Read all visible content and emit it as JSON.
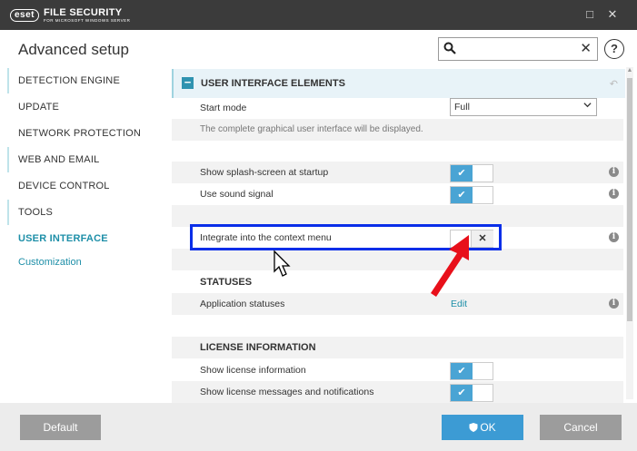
{
  "window": {
    "logo_badge": "eset",
    "logo_main": "FILE SECURITY",
    "logo_sub": "FOR MICROSOFT WINDOWS SERVER",
    "minimize_glyph": "□",
    "close_glyph": "✕"
  },
  "header": {
    "title": "Advanced setup",
    "search": {
      "value": "",
      "placeholder": ""
    },
    "help_label": "?"
  },
  "sidebar": {
    "items": [
      {
        "label": "DETECTION ENGINE",
        "active": false
      },
      {
        "label": "UPDATE",
        "active": false
      },
      {
        "label": "NETWORK PROTECTION",
        "active": false
      },
      {
        "label": "WEB AND EMAIL",
        "active": false
      },
      {
        "label": "DEVICE CONTROL",
        "active": false
      },
      {
        "label": "TOOLS",
        "active": false
      },
      {
        "label": "USER INTERFACE",
        "active": true
      }
    ],
    "sub_item": "Customization"
  },
  "content": {
    "section_title": "USER INTERFACE ELEMENTS",
    "start_mode": {
      "label": "Start mode",
      "value": "Full"
    },
    "start_mode_desc": "The complete graphical user interface will be displayed.",
    "splash": {
      "label": "Show splash-screen at startup",
      "on": true
    },
    "sound": {
      "label": "Use sound signal",
      "on": true
    },
    "context_menu": {
      "label": "Integrate into the context menu",
      "on": false
    },
    "statuses_title": "STATUSES",
    "app_statuses": {
      "label": "Application statuses",
      "link": "Edit"
    },
    "license_title": "LICENSE INFORMATION",
    "show_license": {
      "label": "Show license information",
      "on": true
    },
    "license_messages": {
      "label": "Show license messages and notifications",
      "on": true
    }
  },
  "glyphs": {
    "check": "✔",
    "x": "✕",
    "info": "i",
    "reset": "↶",
    "minus": "−"
  },
  "footer": {
    "default_label": "Default",
    "ok_label": "OK",
    "cancel_label": "Cancel"
  },
  "colors": {
    "accent": "#1e8fa8",
    "toggle_on": "#4aa4d4",
    "highlight_border": "#0a2ee8",
    "annotation_arrow": "#e8101a"
  }
}
